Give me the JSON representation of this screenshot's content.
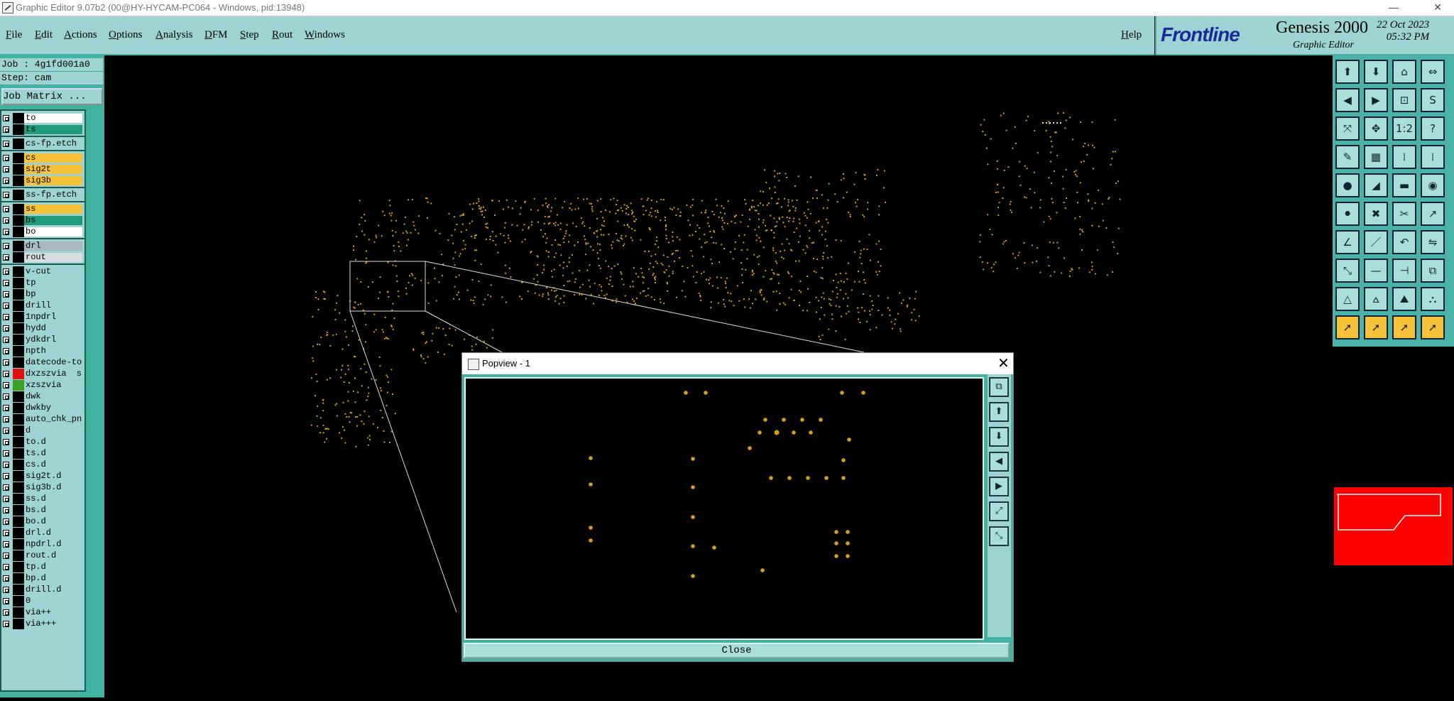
{
  "window": {
    "title": "Graphic Editor 9.07b2 (00@HY-HYCAM-PC064 - Windows, pid:13948)"
  },
  "menu": {
    "items": [
      "File",
      "Edit",
      "Actions",
      "Options",
      "Analysis",
      "DFM",
      "Step",
      "Rout",
      "Windows"
    ],
    "help": "Help"
  },
  "logo": {
    "brand": "Frontline",
    "product": "Genesis 2000",
    "subtitle": "Graphic Editor",
    "date": "22 Oct 2023",
    "time": "05:32 PM"
  },
  "job": {
    "job_line": "Job : 4g1fd001a0",
    "step_line": "Step: cam",
    "matrix_button": "Job Matrix ..."
  },
  "colors": {
    "panel": "#9ed3d3",
    "panel_dark": "#40b4a0",
    "pad": "#d4a020",
    "yellow_layer": "#f6c23a",
    "green_layer": "#1f9a7a",
    "white_layer": "#ffffff",
    "gray_layer": "#a9b7c0"
  },
  "layers": [
    {
      "name": "to",
      "bg": "#ffffff",
      "sw": "#000"
    },
    {
      "name": "ts",
      "bg": "#1f9a7a",
      "sw": "#000"
    },
    {
      "name": "cs-fp.etch",
      "bg": "#9ed3d3",
      "sw": "#000",
      "sep": true
    },
    {
      "name": "cs",
      "bg": "#f6c23a",
      "sw": "#000",
      "sep": true
    },
    {
      "name": "sig2t",
      "bg": "#f6c23a",
      "sw": "#000"
    },
    {
      "name": "sig3b",
      "bg": "#f6c23a",
      "sw": "#000"
    },
    {
      "name": "ss-fp.etch",
      "bg": "#9ed3d3",
      "sw": "#000",
      "sep": true
    },
    {
      "name": "ss",
      "bg": "#f6c23a",
      "sw": "#000",
      "sep": true
    },
    {
      "name": "bs",
      "bg": "#1f9a7a",
      "sw": "#000"
    },
    {
      "name": "bo",
      "bg": "#ffffff",
      "sw": "#000"
    },
    {
      "name": "drl",
      "bg": "#a9b7c0",
      "sw": "#000",
      "sep": true
    },
    {
      "name": "rout",
      "bg": "#d7dde0",
      "sw": "#000"
    },
    {
      "name": "v-cut",
      "bg": "#9ed3d3",
      "sw": "#000",
      "sep": true
    },
    {
      "name": "tp",
      "bg": "#9ed3d3",
      "sw": "#000"
    },
    {
      "name": "bp",
      "bg": "#9ed3d3",
      "sw": "#000"
    },
    {
      "name": "drill",
      "bg": "#9ed3d3",
      "sw": "#000"
    },
    {
      "name": "1npdrl",
      "bg": "#9ed3d3",
      "sw": "#000"
    },
    {
      "name": "hydd",
      "bg": "#9ed3d3",
      "sw": "#000"
    },
    {
      "name": "ydkdrl",
      "bg": "#9ed3d3",
      "sw": "#000"
    },
    {
      "name": "npth",
      "bg": "#9ed3d3",
      "sw": "#000"
    },
    {
      "name": "datecode-to",
      "bg": "#9ed3d3",
      "sw": "#000"
    },
    {
      "name": "dxzszvia",
      "bg": "#9ed3d3",
      "sw": "#e01010",
      "extra": "s"
    },
    {
      "name": "xzszvia",
      "bg": "#9ed3d3",
      "sw": "#3aa020"
    },
    {
      "name": "dwk",
      "bg": "#9ed3d3",
      "sw": "#000"
    },
    {
      "name": "dwkby",
      "bg": "#9ed3d3",
      "sw": "#000"
    },
    {
      "name": "auto_chk_pnl",
      "bg": "#9ed3d3",
      "sw": "#000"
    },
    {
      "name": "d",
      "bg": "#9ed3d3",
      "sw": "#000"
    },
    {
      "name": "to.d",
      "bg": "#9ed3d3",
      "sw": "#000"
    },
    {
      "name": "ts.d",
      "bg": "#9ed3d3",
      "sw": "#000"
    },
    {
      "name": "cs.d",
      "bg": "#9ed3d3",
      "sw": "#000"
    },
    {
      "name": "sig2t.d",
      "bg": "#9ed3d3",
      "sw": "#000"
    },
    {
      "name": "sig3b.d",
      "bg": "#9ed3d3",
      "sw": "#000"
    },
    {
      "name": "ss.d",
      "bg": "#9ed3d3",
      "sw": "#000"
    },
    {
      "name": "bs.d",
      "bg": "#9ed3d3",
      "sw": "#000"
    },
    {
      "name": "bo.d",
      "bg": "#9ed3d3",
      "sw": "#000"
    },
    {
      "name": "drl.d",
      "bg": "#9ed3d3",
      "sw": "#000"
    },
    {
      "name": "npdrl.d",
      "bg": "#9ed3d3",
      "sw": "#000"
    },
    {
      "name": "rout.d",
      "bg": "#9ed3d3",
      "sw": "#000"
    },
    {
      "name": "tp.d",
      "bg": "#9ed3d3",
      "sw": "#000"
    },
    {
      "name": "bp.d",
      "bg": "#9ed3d3",
      "sw": "#000"
    },
    {
      "name": "drill.d",
      "bg": "#9ed3d3",
      "sw": "#000"
    },
    {
      "name": "0",
      "bg": "#9ed3d3",
      "sw": "#000"
    },
    {
      "name": "via++",
      "bg": "#9ed3d3",
      "sw": "#000"
    },
    {
      "name": "via+++",
      "bg": "#9ed3d3",
      "sw": "#000"
    }
  ],
  "toolbar": {
    "buttons": [
      {
        "icon": "zoom-home-icon"
      },
      {
        "icon": "zoom-home2-icon"
      },
      {
        "icon": "house-icon"
      },
      {
        "icon": "scale-icon"
      },
      {
        "icon": "pan-left-icon"
      },
      {
        "icon": "pan-right-icon"
      },
      {
        "icon": "zoom-box-icon"
      },
      {
        "icon": "s-curve-icon"
      },
      {
        "icon": "fit-all-icon"
      },
      {
        "icon": "zoom-in-icon"
      },
      {
        "icon": "one-to-one-icon"
      },
      {
        "icon": "help-icon"
      },
      {
        "icon": "measure-icon"
      },
      {
        "icon": "grid-icon"
      },
      {
        "icon": "snap-icon"
      },
      {
        "icon": "snap2-icon"
      },
      {
        "icon": "add-pad-icon"
      },
      {
        "icon": "add-line-icon"
      },
      {
        "icon": "add-text-icon"
      },
      {
        "icon": "add-circle-icon"
      },
      {
        "icon": "move-icon"
      },
      {
        "icon": "delete-icon"
      },
      {
        "icon": "copy-icon"
      },
      {
        "icon": "connect-icon"
      },
      {
        "icon": "angle-icon"
      },
      {
        "icon": "line-draw-icon"
      },
      {
        "icon": "arc-icon"
      },
      {
        "icon": "mirror-icon"
      },
      {
        "icon": "resize-icon"
      },
      {
        "icon": "cut-line-icon"
      },
      {
        "icon": "break-icon"
      },
      {
        "icon": "group-icon"
      },
      {
        "icon": "outline-icon"
      },
      {
        "icon": "slot-icon"
      },
      {
        "icon": "contour-icon"
      },
      {
        "icon": "fill-icon"
      },
      {
        "icon": "pointer-icon",
        "yellow": true
      },
      {
        "icon": "pointer2-icon",
        "yellow": true
      },
      {
        "icon": "pointer3-icon",
        "yellow": true
      },
      {
        "icon": "pointer4-icon",
        "yellow": true
      }
    ]
  },
  "popview": {
    "title": "Popview - 1",
    "close_label": "Close"
  }
}
